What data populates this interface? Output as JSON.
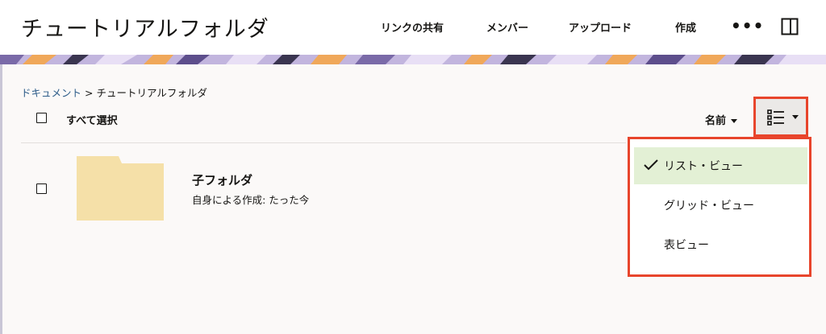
{
  "header": {
    "title": "チュートリアルフォルダ",
    "share_link_label": "リンクの共有",
    "members_label": "メンバー",
    "upload_label": "アップロード",
    "create_label": "作成",
    "more_label": "•••"
  },
  "breadcrumb": {
    "root": "ドキュメント",
    "separator": ">",
    "current": "チュートリアルフォルダ"
  },
  "toolbar": {
    "select_all_label": "すべて選択",
    "sort_label": "名前"
  },
  "items": [
    {
      "name": "子フォルダ",
      "meta": "自身による作成: たった今"
    }
  ],
  "view_menu": {
    "options": [
      "リスト・ビュー",
      "グリッド・ビュー",
      "表ビュー"
    ],
    "selected": "リスト・ビュー"
  },
  "colors": {
    "highlight_border": "#e8452c",
    "selected_bg": "#e3f0d5",
    "folder": "#f5e0a8",
    "link": "#2e5d8a"
  }
}
